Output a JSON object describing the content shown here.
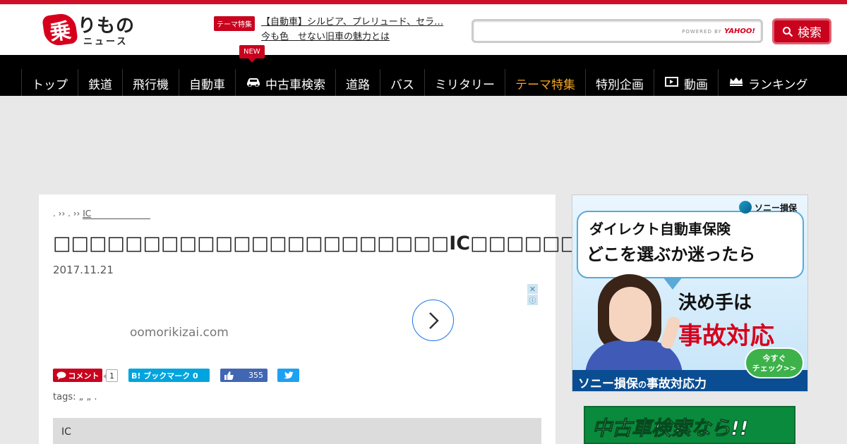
{
  "brand": {
    "logo_mark": "乗",
    "logo_main": "りもの",
    "logo_sub": "ニュース"
  },
  "header": {
    "theme_badge": "テーマ特集",
    "news_line1": "【自動車】シルビア、プレリュード、セラ…",
    "news_line2": "今も色　せない旧車の魅力とは",
    "new_badge": "NEW",
    "search_placeholder": "",
    "powered_by": "POWERED BY",
    "powered_brand": "YAHOO!",
    "search_button": "検索"
  },
  "nav": {
    "items": [
      {
        "label": "トップ",
        "icon": ""
      },
      {
        "label": "鉄道",
        "icon": ""
      },
      {
        "label": "飛行機",
        "icon": ""
      },
      {
        "label": "自動車",
        "icon": ""
      },
      {
        "label": "中古車検索",
        "icon": "car-icon"
      },
      {
        "label": "道路",
        "icon": ""
      },
      {
        "label": "バス",
        "icon": ""
      },
      {
        "label": "ミリタリー",
        "icon": ""
      },
      {
        "label": "テーマ特集",
        "icon": "",
        "active": true
      },
      {
        "label": "特別企画",
        "icon": ""
      },
      {
        "label": "動画",
        "icon": "video-icon"
      },
      {
        "label": "ランキング",
        "icon": "crown-icon"
      }
    ],
    "active_color": "#f5a623"
  },
  "article": {
    "breadcrumb": [
      ".",
      "››",
      ".",
      "››",
      "IC"
    ],
    "title": "□□□□□□□□□□□□□□□□□□□□□□IC□□□□□□□□□□",
    "date": "2017.11.21",
    "ad_url": "oomorikizai.com",
    "ad_close": "✕",
    "ad_info": "ⓘ",
    "share": {
      "comment_label": "コメント",
      "comment_count": "1",
      "hatena_label": "B! ブックマーク 0",
      "like_count": "355"
    },
    "tags": "tags: „ „ .",
    "section_label": "IC"
  },
  "sidebar_ad": {
    "brand": "ソニー損保",
    "line1": "ダイレクト自動車保険",
    "line2": "どこを選ぶか迷ったら",
    "line3": "決め手は",
    "line4": "事故対応",
    "bottom_main": "ソニー損保",
    "bottom_mid": "の",
    "bottom_end": "事故対応力",
    "check_line1": "今すぐ",
    "check_line2": "チェック>>"
  },
  "sidebar_ad2": {
    "text": "中古車検索なら!!"
  },
  "colors": {
    "brand_red": "#c9021e",
    "nav_bg": "#000000",
    "page_bg": "#e8e8e8",
    "facebook": "#4267b2",
    "twitter": "#1da1f2",
    "hatena": "#00a4de"
  }
}
